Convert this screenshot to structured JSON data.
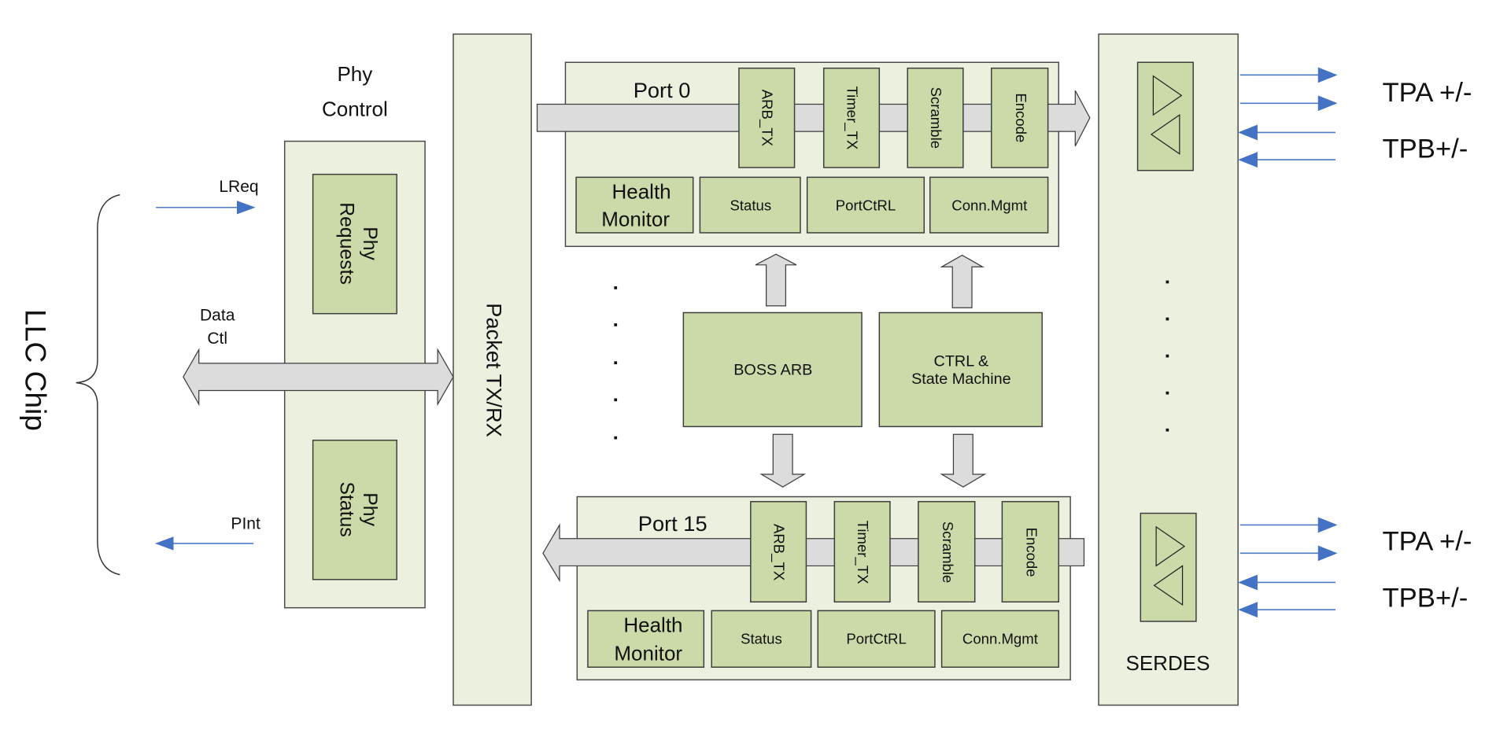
{
  "diagram": {
    "llc": {
      "label": "LLC Chip"
    },
    "signals": {
      "lreq": "LReq",
      "data_ctl_line1": "Data",
      "data_ctl_line2": "Ctl",
      "pint": "PInt"
    },
    "phy_control": {
      "title_line1": "Phy",
      "title_line2": "Control",
      "requests_line1": "Phy",
      "requests_line2": "Requests",
      "status_line1": "Phy",
      "status_line2": "Status"
    },
    "packet": {
      "label": "Packet TX/RX"
    },
    "ports": [
      {
        "name": "Port 0",
        "pipeline": [
          "ARB_TX",
          "Timer_TX",
          "Scramble",
          "Encode"
        ],
        "health_line1": "Health",
        "health_line2": "Monitor",
        "blocks": [
          "Status",
          "PortCtRL",
          "Conn.Mgmt"
        ],
        "direction": "tx"
      },
      {
        "name": "Port 15",
        "pipeline": [
          "ARB_TX",
          "Timer_TX",
          "Scramble",
          "Encode"
        ],
        "health_line1": "Health",
        "health_line2": "Monitor",
        "blocks": [
          "Status",
          "PortCtRL",
          "Conn.Mgmt"
        ],
        "direction": "rx"
      }
    ],
    "boss_arb": "BOSS ARB",
    "ctrl_line1": "CTRL &",
    "ctrl_line2": "State Machine",
    "ellipsis": ".",
    "serdes": {
      "label": "SERDES"
    },
    "lines": {
      "tpa": "TPA +/-",
      "tpb": "TPB+/-"
    },
    "colors": {
      "outer_fill": "#ebf0df",
      "block_fill": "#cbdaa8",
      "bus_fill": "#dcdcdc",
      "signal_blue": "#4472c4"
    }
  }
}
